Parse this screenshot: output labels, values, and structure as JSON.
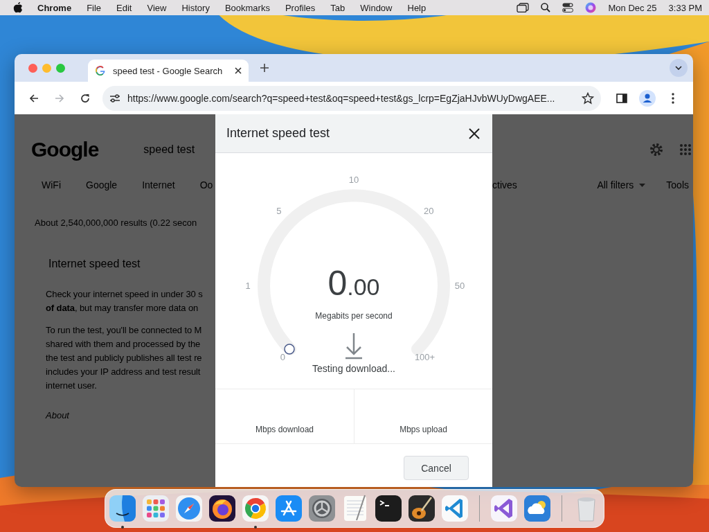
{
  "menu_bar": {
    "app": "Chrome",
    "menus": [
      "File",
      "Edit",
      "View",
      "History",
      "Bookmarks",
      "Profiles",
      "Tab",
      "Window",
      "Help"
    ],
    "date": "Mon Dec 25",
    "time": "3:33 PM"
  },
  "browser": {
    "tabs": [
      {
        "title": "speed test - Google Search",
        "selected": true
      }
    ],
    "url": "https://www.google.com/search?q=speed+test&oq=speed+test&gs_lcrp=EgZjaHJvbWUyDwgAEE...",
    "forward_disabled": true
  },
  "page": {
    "logo": "Google",
    "query": "speed test",
    "filters_left": [
      "WiFi",
      "Google",
      "Internet",
      "Oo"
    ],
    "filters_right": [
      "ctives"
    ],
    "all_filters": "All filters",
    "tools": "Tools",
    "result_stats": "About 2,540,000,000 results (0.22 secon",
    "card": {
      "title": "Internet speed test",
      "paragraphs": [
        [
          "Check your internet speed in under 30 s",
          "**of data**, but may transfer more data on"
        ],
        [
          "To run the test, you'll be connected to M",
          "shared with them and processed by the",
          "the test and publicly publishes all test re",
          "includes your IP address and test result",
          "internet user."
        ]
      ],
      "about": "About"
    }
  },
  "dialog": {
    "title": "Internet speed test",
    "gauge": {
      "ticks": [
        "0",
        "1",
        "5",
        "10",
        "20",
        "50",
        "100+"
      ],
      "value_whole": "0",
      "value_fraction": ".00",
      "unit": "Megabits per second",
      "status": "Testing download..."
    },
    "results": [
      "Mbps download",
      "Mbps upload"
    ],
    "cancel": "Cancel"
  },
  "dock": [
    {
      "kind": "finder",
      "running": true
    },
    {
      "kind": "launchpad",
      "running": false
    },
    {
      "kind": "safari",
      "running": false
    },
    {
      "kind": "firefox",
      "running": false
    },
    {
      "kind": "chrome",
      "running": true
    },
    {
      "kind": "appstore",
      "running": false
    },
    {
      "kind": "settings",
      "running": false
    },
    {
      "kind": "textedit",
      "running": false
    },
    {
      "kind": "terminal",
      "running": false
    },
    {
      "kind": "garageband",
      "running": false
    },
    {
      "kind": "vscode",
      "running": false
    },
    {
      "kind": "separator"
    },
    {
      "kind": "visualstudio",
      "running": false
    },
    {
      "kind": "weather",
      "running": false
    },
    {
      "kind": "separator"
    },
    {
      "kind": "trash",
      "running": false
    }
  ]
}
